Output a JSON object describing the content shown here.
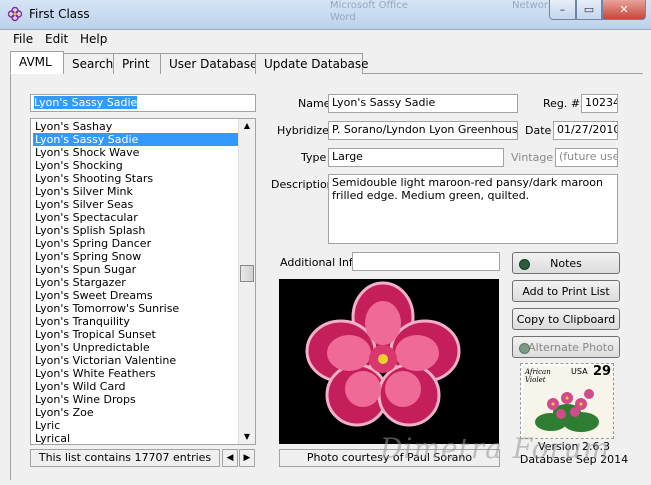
{
  "window": {
    "title": "First Class",
    "ghost_title": "Microsoft Office\nWord",
    "ghost_title2": "Network",
    "min_label": "–",
    "max_label": "▭",
    "close_label": "✕"
  },
  "menu": [
    "File",
    "Edit",
    "Help"
  ],
  "tabs": [
    "AVML",
    "Search",
    "Print",
    "User Database",
    "Update Database"
  ],
  "search_value": "Lyon's Sassy Sadie",
  "list": {
    "items": [
      "Lyon's Sashay",
      "Lyon's Sassy Sadie",
      "Lyon's Shock Wave",
      "Lyon's Shocking",
      "Lyon's Shooting Stars",
      "Lyon's Silver Mink",
      "Lyon's Silver Seas",
      "Lyon's Spectacular",
      "Lyon's Splish Splash",
      "Lyon's Spring Dancer",
      "Lyon's Spring Snow",
      "Lyon's Spun Sugar",
      "Lyon's Stargazer",
      "Lyon's Sweet Dreams",
      "Lyon's Tomorrow's Sunrise",
      "Lyon's Tranquility",
      "Lyon's Tropical Sunset",
      "Lyon's Unpredictable",
      "Lyon's Victorian Valentine",
      "Lyon's White Feathers",
      "Lyon's Wild Card",
      "Lyon's Wine Drops",
      "Lyon's Zoe",
      "Lyric",
      "Lyrical"
    ],
    "selected_index": 1,
    "footer": "This list contains 17707 entries",
    "scroll_position": 0.47
  },
  "fields": {
    "name_label": "Name",
    "name_value": "Lyon's Sassy Sadie",
    "reg_label": "Reg. #",
    "reg_value": "10234",
    "hybridizer_label": "Hybridizer",
    "hybridizer_value": "P. Sorano/Lyndon Lyon Greenhouses",
    "date_label": "Date",
    "date_value": "01/27/2010",
    "type_label": "Type",
    "type_value": "Large",
    "vintage_label": "Vintage",
    "vintage_value": "(future use)",
    "description_label": "Description",
    "description_value": "Semidouble light maroon-red pansy/dark maroon frilled edge. Medium green, quilted.",
    "additional_label": "Additional Info",
    "additional_value": ""
  },
  "buttons": {
    "notes": "Notes",
    "add_print": "Add to Print List",
    "copy_clip": "Copy to Clipboard",
    "alt_photo": "Alternate Photo"
  },
  "photo_caption": "Photo courtesy of Paul Sorano",
  "stamp": {
    "text": "African Violet",
    "country": "USA",
    "value": "29"
  },
  "version": {
    "line1": "Version 2.6.3",
    "line2": "Database Sep 2014"
  },
  "watermark": "Dimetra Forum",
  "colors": {
    "selection": "#3399ff",
    "led": "#2c5e3a",
    "flower": "#e0306a"
  }
}
